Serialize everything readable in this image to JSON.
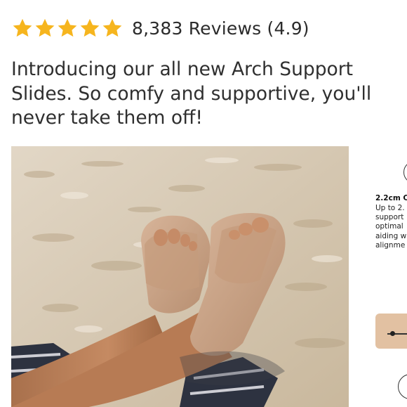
{
  "rating": {
    "stars_filled": 5,
    "stars_total": 5,
    "star_color": "#f6b51e",
    "star_icon": "star-icon",
    "reviews_text": "8,383 Reviews (4.9)"
  },
  "product": {
    "headline": "Introducing our all new Arch Support Slides. So comfy and supportive, you'll never take them off!"
  },
  "side_panel": {
    "title": "2.2cm C",
    "body_lines": [
      "Up to 2.",
      "support",
      "optimal",
      "aiding w",
      "alignme"
    ]
  },
  "colors": {
    "sand": "#d8cbb7",
    "slide": "#c9a286"
  }
}
